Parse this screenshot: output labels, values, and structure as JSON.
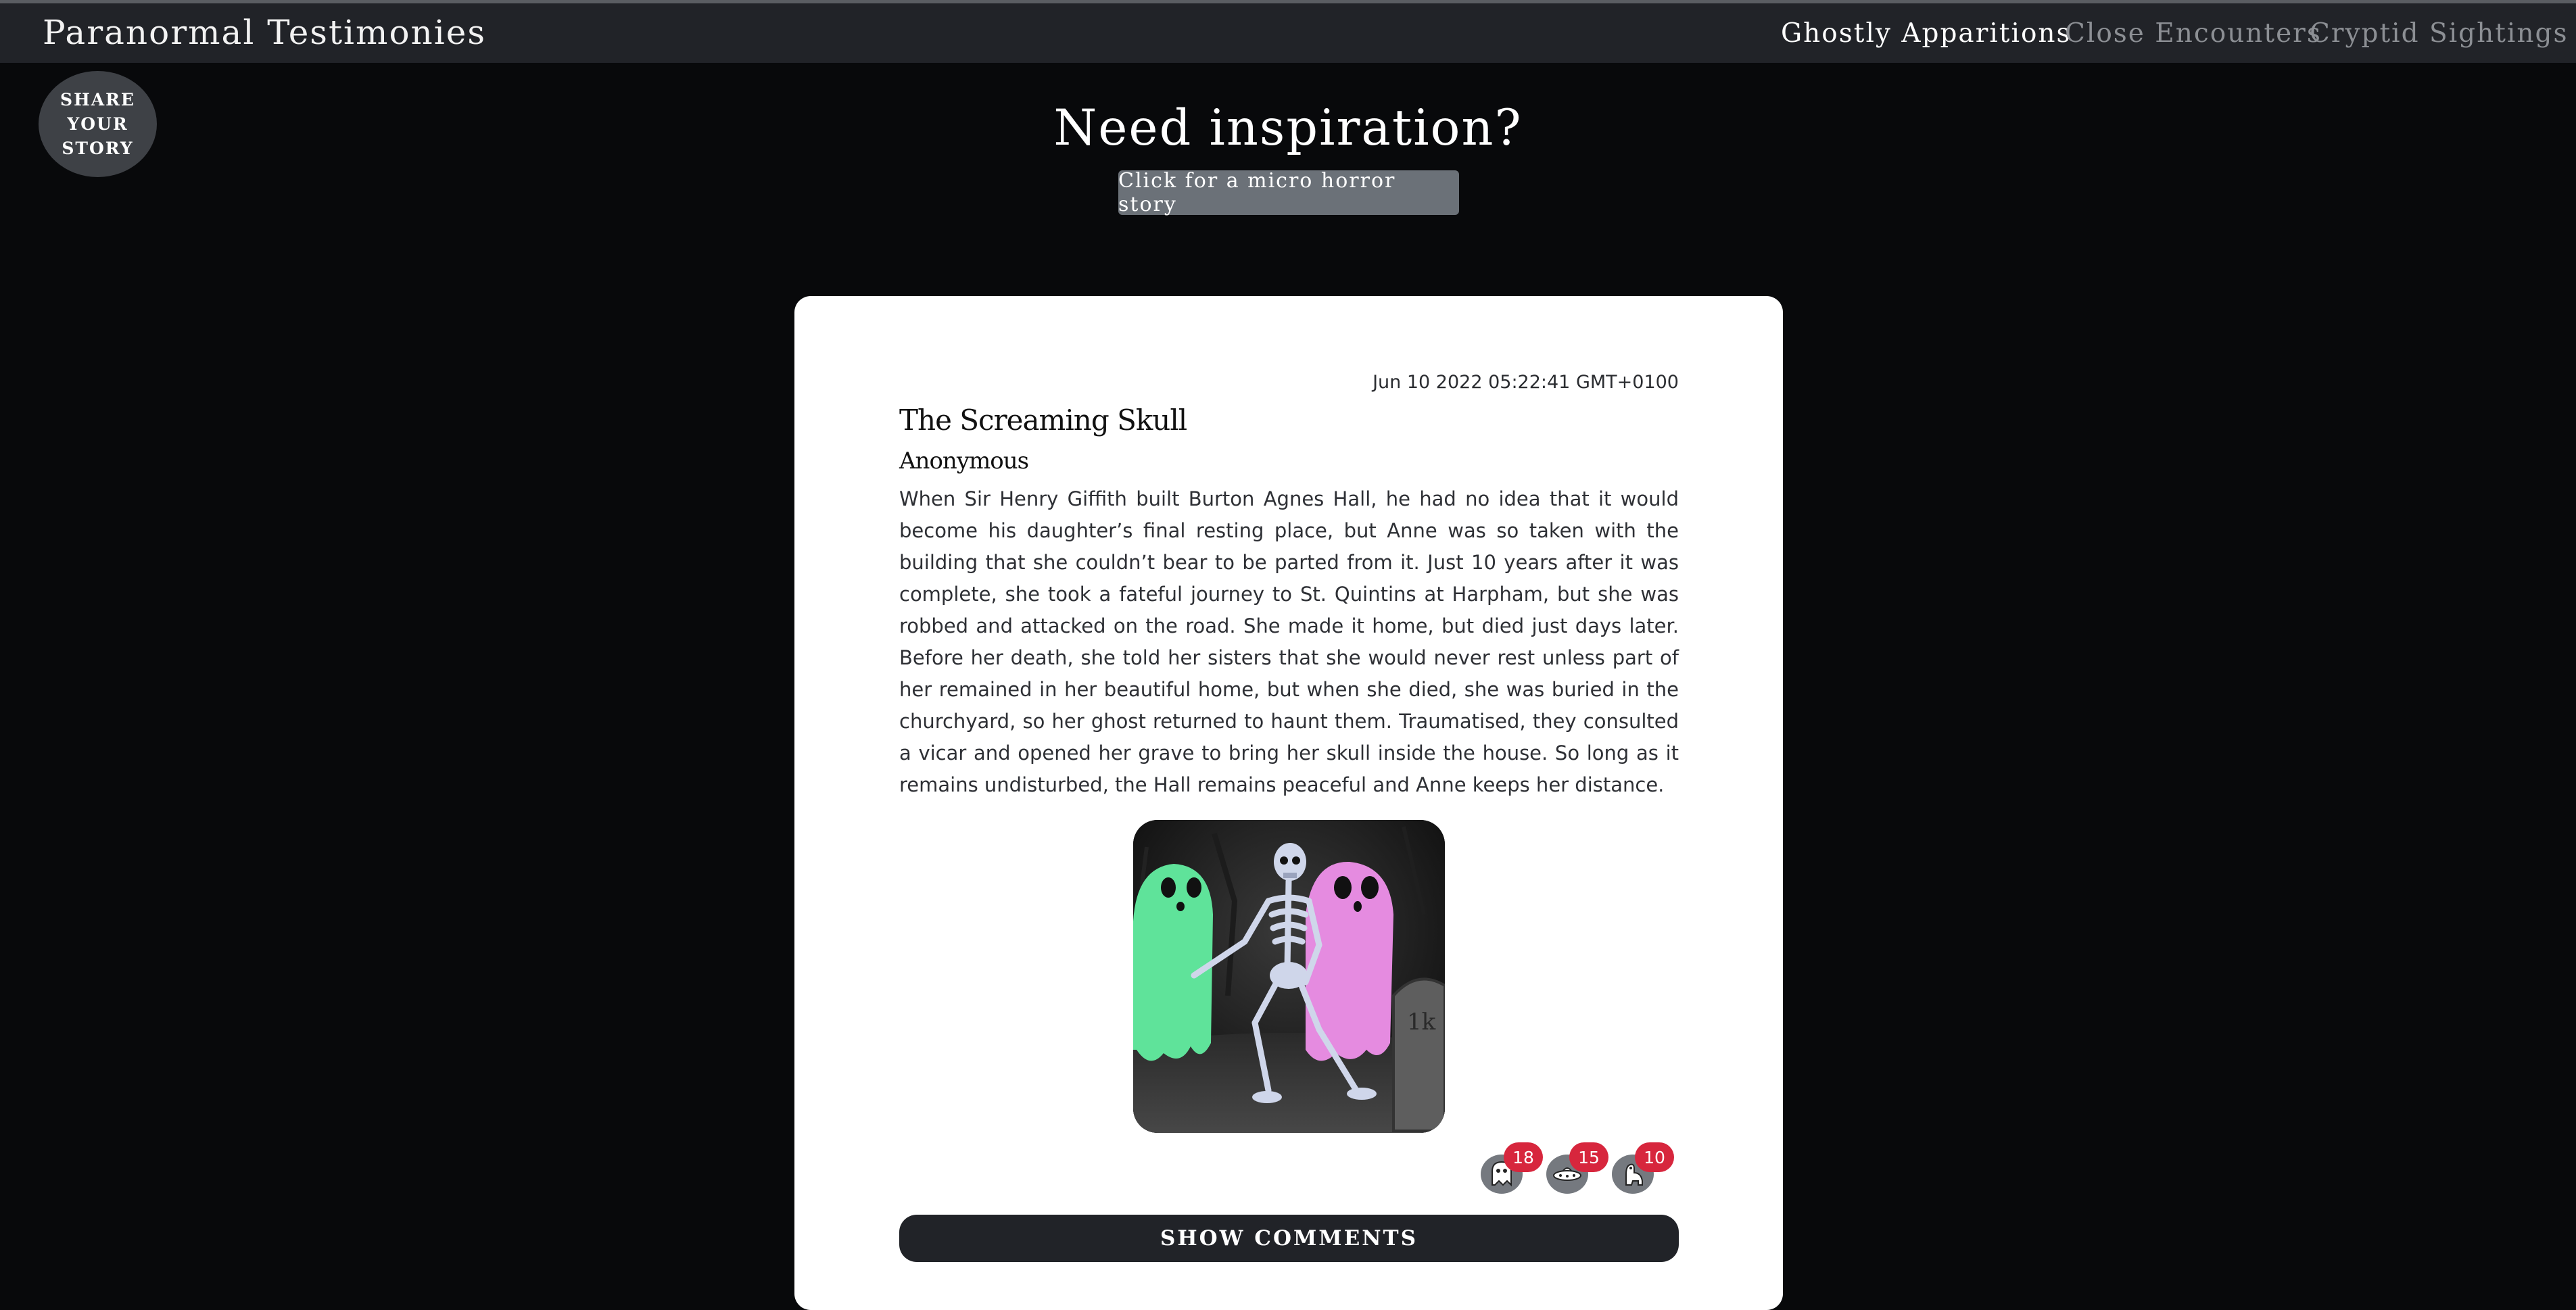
{
  "navbar": {
    "brand": "Paranormal Testimonies",
    "links": [
      {
        "label": "Ghostly Apparitions",
        "active": true
      },
      {
        "label": "Close Encounters",
        "active": false
      },
      {
        "label": "Cryptid Sightings",
        "active": false
      }
    ]
  },
  "share_button": {
    "line1": "SHARE",
    "line2": "YOUR",
    "line3": "STORY"
  },
  "inspiration": {
    "title": "Need inspiration?",
    "button_label": "Click for a micro horror story"
  },
  "post": {
    "date": "Jun 10 2022 05:22:41 GMT+0100",
    "title": "The Screaming Skull",
    "author": "Anonymous",
    "body": "When Sir Henry Giffith built Burton Agnes Hall, he had no idea that it would become his daughter’s final resting place, but Anne was so taken with the building that she couldn’t bear to be parted from it. Just 10 years after it was complete, she took a fateful journey to St. Quintins at Harpham, but she was robbed and attacked on the road. She made it home, but died just days later. Before her death, she told her sisters that she would never rest unless part of her remained in her beautiful home, but when she died, she was buried in the churchyard, so her ghost returned to haunt them. Traumatised, they consulted a vicar and opened her grave to bring her skull inside the house. So long as it remains undisturbed, the Hall remains peaceful and Anne keeps her distance.",
    "image_icon": "skeleton-ghosts-illustration",
    "reactions": [
      {
        "icon": "ghost-icon",
        "count": "18"
      },
      {
        "icon": "ufo-icon",
        "count": "15"
      },
      {
        "icon": "cryptid-icon",
        "count": "10"
      }
    ],
    "comments_label": "SHOW COMMENTS"
  },
  "colors": {
    "background": "#08090b",
    "navbar": "#212328",
    "badge": "#d7263d",
    "ghost_green": "#5fe39a",
    "ghost_pink": "#e58be0"
  }
}
